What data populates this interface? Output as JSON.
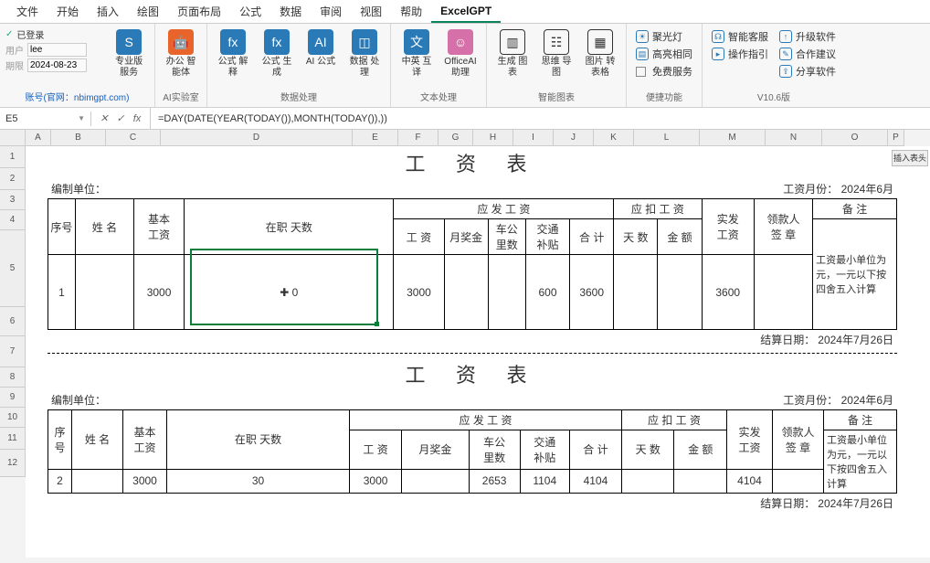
{
  "menu": {
    "items": [
      "文件",
      "开始",
      "插入",
      "绘图",
      "页面布局",
      "公式",
      "数据",
      "审阅",
      "视图",
      "帮助",
      "ExcelGPT"
    ],
    "active": "ExcelGPT"
  },
  "ribbon": {
    "login": {
      "status_icon": "✓",
      "status": "已登录",
      "user_lbl": "用户",
      "user": "lee",
      "exp_lbl": "期限",
      "exp": "2024-08-23",
      "account": "账号(官网：nbimgpt.com)"
    },
    "g1": {
      "btn1": "专业版\n服务",
      "btn2": "办公\n智能体",
      "label": "AI实验室"
    },
    "g2": {
      "b1": "公式\n解释",
      "b2": "公式\n生成",
      "b3": "AI\n公式",
      "b4": "数据\n处理",
      "label": "数据处理"
    },
    "g3": {
      "b1": "中英\n互译",
      "b2": "OfficeAI\n助理",
      "label": "文本处理"
    },
    "g4": {
      "b1": "生成\n图表",
      "b2": "思维\n导图",
      "b3": "图片\n转表格",
      "label": "智能图表"
    },
    "g5": {
      "a": "聚光灯",
      "b": "高亮相同",
      "c": "免费服务",
      "label": "便捷功能"
    },
    "g6": {
      "a": "智能客服",
      "b": "操作指引",
      "c": "升级软件",
      "d": "合作建议",
      "e": "分享软件",
      "label": "V10.6版"
    }
  },
  "formula": {
    "cell": "E5",
    "fx": "fx",
    "value": "=DAY(DATE(YEAR(TODAY()),MONTH(TODAY()),))"
  },
  "cols": [
    "A",
    "B",
    "C",
    "D",
    "E",
    "F",
    "G",
    "H",
    "I",
    "J",
    "K",
    "L",
    "M",
    "N",
    "O",
    "P"
  ],
  "rowNums": [
    "1",
    "2",
    "3",
    "4",
    "5",
    "6",
    "7",
    "8",
    "9",
    "10",
    "11",
    "12"
  ],
  "side_btn": "插入表头",
  "sheet": {
    "title": "工 资 表",
    "unit_lbl": "编制单位：",
    "month_lbl": "工资月份：",
    "month": "2024年6月",
    "settle_lbl": "结算日期：",
    "settle": "2024年7月26日",
    "h": {
      "seq": "序号",
      "name": "姓 名",
      "base": "基本\n工资",
      "days": "在职 天数",
      "pay": "应 发 工 资",
      "wage": "工 资",
      "bonus": "月奖金",
      "car": "车公\n里数",
      "traf": "交通\n补贴",
      "sum": "合 计",
      "ded": "应 扣 工 资",
      "dday": "天 数",
      "damt": "金 额",
      "net": "实发\n工资",
      "sign": "领款人\n签 章",
      "remark": "备 注",
      "note": "工资最小单位为元，一元以下按四舍五入计算"
    },
    "r1": {
      "seq": "1",
      "base": "3000",
      "days": "0",
      "wage": "3000",
      "traf": "600",
      "sum": "3600",
      "net": "3600"
    },
    "r2": {
      "seq": "2",
      "base": "3000",
      "days": "30",
      "wage": "3000",
      "car": "2653",
      "traf": "1104",
      "sum": "4104",
      "net": "4104"
    }
  },
  "chart_data": {
    "type": "table",
    "title": "工资表 (Payroll)",
    "columns": [
      "序号",
      "姓名",
      "基本工资",
      "在职天数",
      "工资",
      "月奖金",
      "车公里数",
      "交通补贴",
      "合计",
      "应扣天数",
      "应扣金额",
      "实发工资"
    ],
    "rows": [
      [
        1,
        "",
        3000,
        0,
        3000,
        null,
        null,
        600,
        3600,
        null,
        null,
        3600
      ],
      [
        2,
        "",
        3000,
        30,
        3000,
        null,
        2653,
        1104,
        4104,
        null,
        null,
        4104
      ]
    ]
  }
}
